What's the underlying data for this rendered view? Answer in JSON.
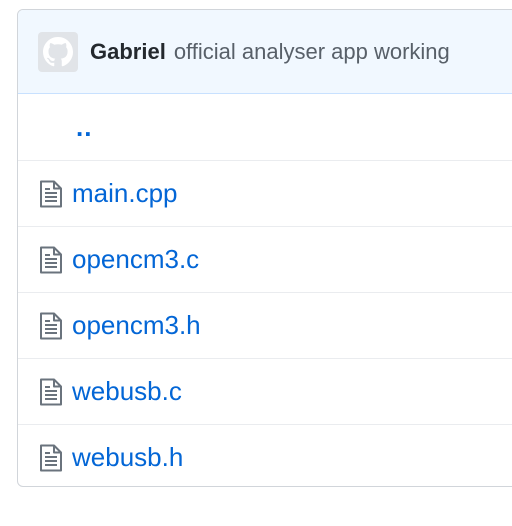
{
  "commit": {
    "author": "Gabriel",
    "message": "official analyser app working",
    "avatar_icon": "octocat-avatar-icon"
  },
  "parent_dir": {
    "label": ".."
  },
  "files": [
    {
      "name": "main.cpp",
      "icon": "file-icon"
    },
    {
      "name": "opencm3.c",
      "icon": "file-icon"
    },
    {
      "name": "opencm3.h",
      "icon": "file-icon"
    },
    {
      "name": "webusb.c",
      "icon": "file-icon"
    },
    {
      "name": "webusb.h",
      "icon": "file-icon"
    }
  ],
  "colors": {
    "link": "#0366d6",
    "header_bg": "#f1f8ff",
    "border": "#d1d5da"
  }
}
